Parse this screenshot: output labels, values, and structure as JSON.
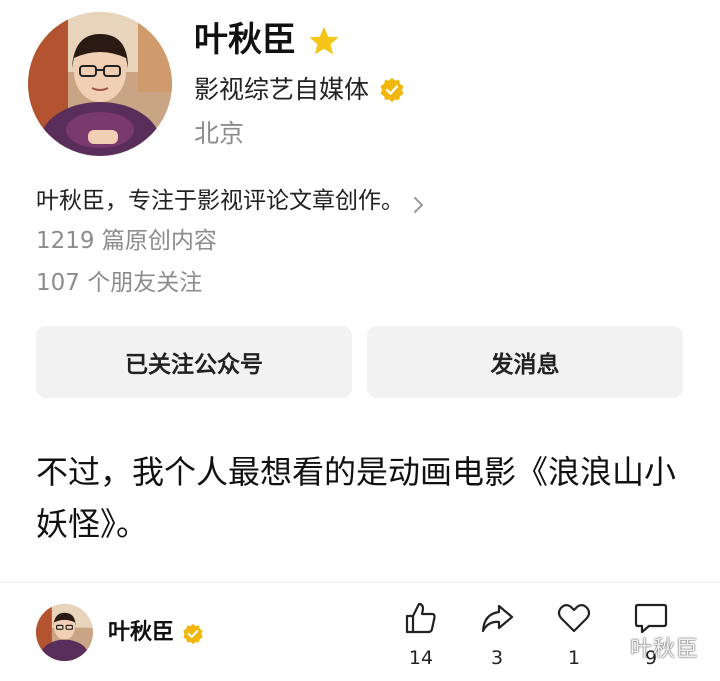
{
  "profile": {
    "name": "叶秋臣",
    "account_type": "影视综艺自媒体",
    "location": "北京",
    "intro": "叶秋臣，专注于影视评论文章创作。",
    "articles": "1219 篇原创内容",
    "friends": "107 个朋友关注"
  },
  "buttons": {
    "follow": "已关注公众号",
    "message": "发消息"
  },
  "post": {
    "text": "不过，我个人最想看的是动画电影《浪浪山小妖怪》。"
  },
  "footer": {
    "name": "叶秋臣",
    "likes": "14",
    "shares": "3",
    "hearts": "1",
    "comments": "9",
    "watermark": "叶秋臣"
  },
  "colors": {
    "star": "#f5c518",
    "verify": "#f2b70c",
    "button_bg": "#f2f2f2",
    "muted_text": "#8c8c8c"
  }
}
